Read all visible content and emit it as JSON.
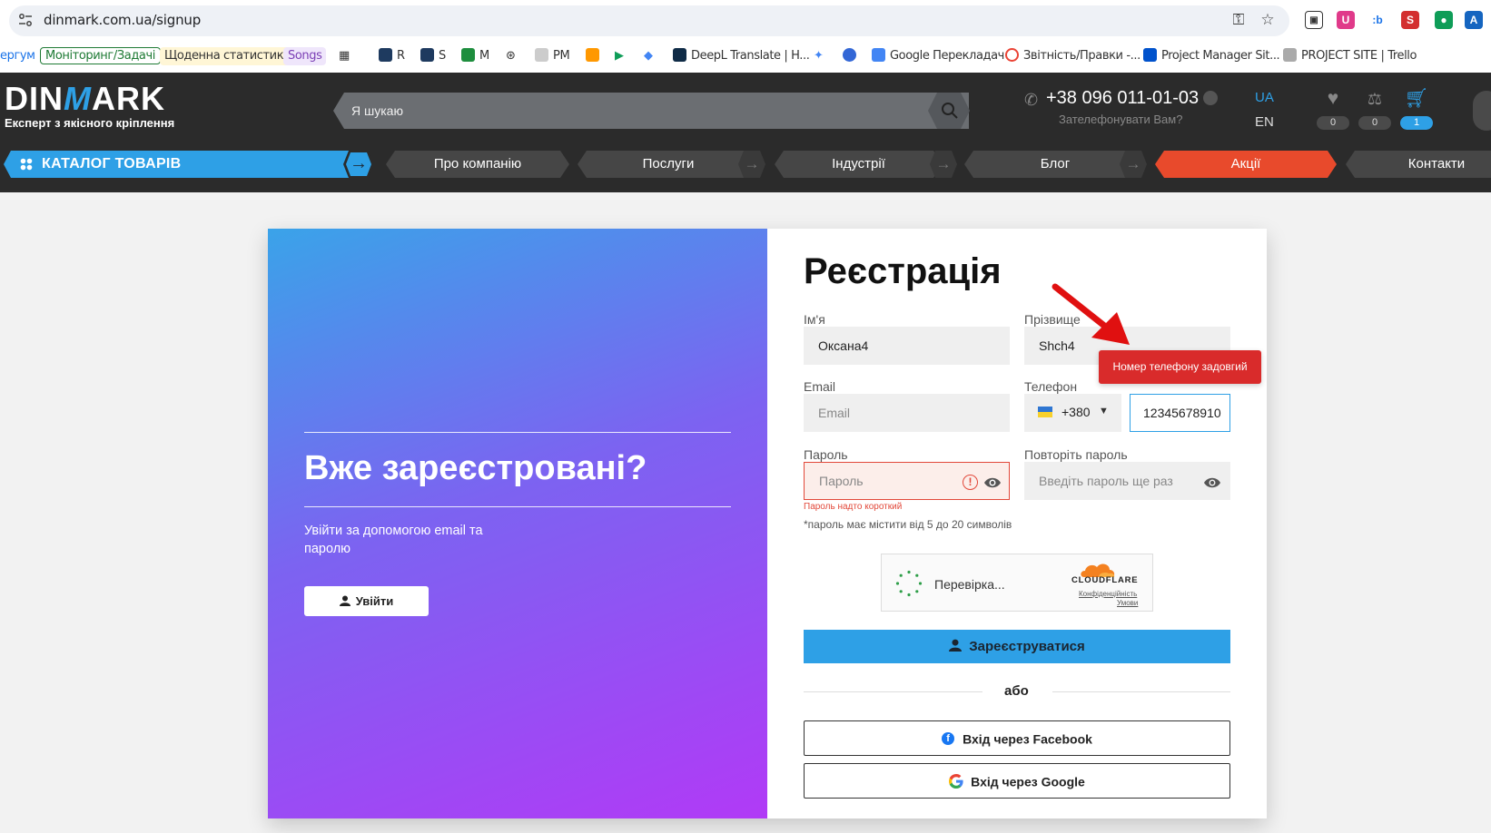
{
  "browser": {
    "url": "dinmark.com.ua/signup",
    "bookmarks": [
      {
        "label": "ергум",
        "color": "#1a73e8"
      },
      {
        "label": "Моніторинг/Задачі",
        "color": "#1e7a34"
      },
      {
        "label": "Щоденна статистика",
        "color": "#444444"
      },
      {
        "label": "Songs",
        "color": "#7b3fb5"
      },
      {
        "label": "R"
      },
      {
        "label": "S"
      },
      {
        "label": "M"
      },
      {
        "label": "PM"
      },
      {
        "label": "DeepL Translate | H..."
      },
      {
        "label": "Google Перекладач"
      },
      {
        "label": "Звітність/Правки -..."
      },
      {
        "label": "Project Manager Sit..."
      },
      {
        "label": "PROJECT SITE | Trello"
      }
    ]
  },
  "header": {
    "logo_text_a": "DIN",
    "logo_text_m": "M",
    "logo_text_b": "ARK",
    "logo_tagline": "Експерт з якісного кріплення",
    "search_placeholder": "Я шукаю",
    "phone": "+38 096 011-01-03",
    "phone_callback": "Зателефонувати Вам?",
    "lang_active": "UA",
    "lang_other": "EN",
    "wishlist_count": "0",
    "compare_count": "0",
    "cart_count": "1",
    "accent_color": "#2ea0e6"
  },
  "nav": {
    "catalog": "КАТАЛОГ ТОВАРІВ",
    "items": [
      "Про компанію",
      "Послуги",
      "Індустрії",
      "Блог",
      "Акції",
      "Контакти"
    ],
    "sale_color": "#e84a2c"
  },
  "left_panel": {
    "title": "Вже зареєстровані?",
    "subtitle": "Увійти за допомогою email та паролю",
    "login_button": "Увійти"
  },
  "form": {
    "title": "Реєстрація",
    "first_name_label": "Ім'я",
    "first_name_value": "Оксана4",
    "last_name_label": "Прізвище",
    "last_name_value": "Shch4",
    "email_label": "Email",
    "email_placeholder": "Email",
    "phone_label": "Телефон",
    "phone_code": "+380",
    "phone_value": "12345678910",
    "password_label": "Пароль",
    "password_placeholder": "Пароль",
    "password_error": "Пароль надто короткий",
    "password_repeat_label": "Повторіть пароль",
    "password_repeat_placeholder": "Введіть пароль ще раз",
    "password_hint": "*пароль має містити від 5 до 20 символів",
    "phone_tooltip": "Номер телефону задовгий",
    "error_color": "#e2483a",
    "captcha_status": "Перевірка...",
    "captcha_brand": "CLOUDFLARE",
    "captcha_privacy": "Конфіденційність",
    "captcha_terms": "Умови",
    "register_button": "Зареєструватися",
    "or_text": "або",
    "facebook_button": "Вхід через Facebook",
    "google_button": "Вхід через Google"
  }
}
